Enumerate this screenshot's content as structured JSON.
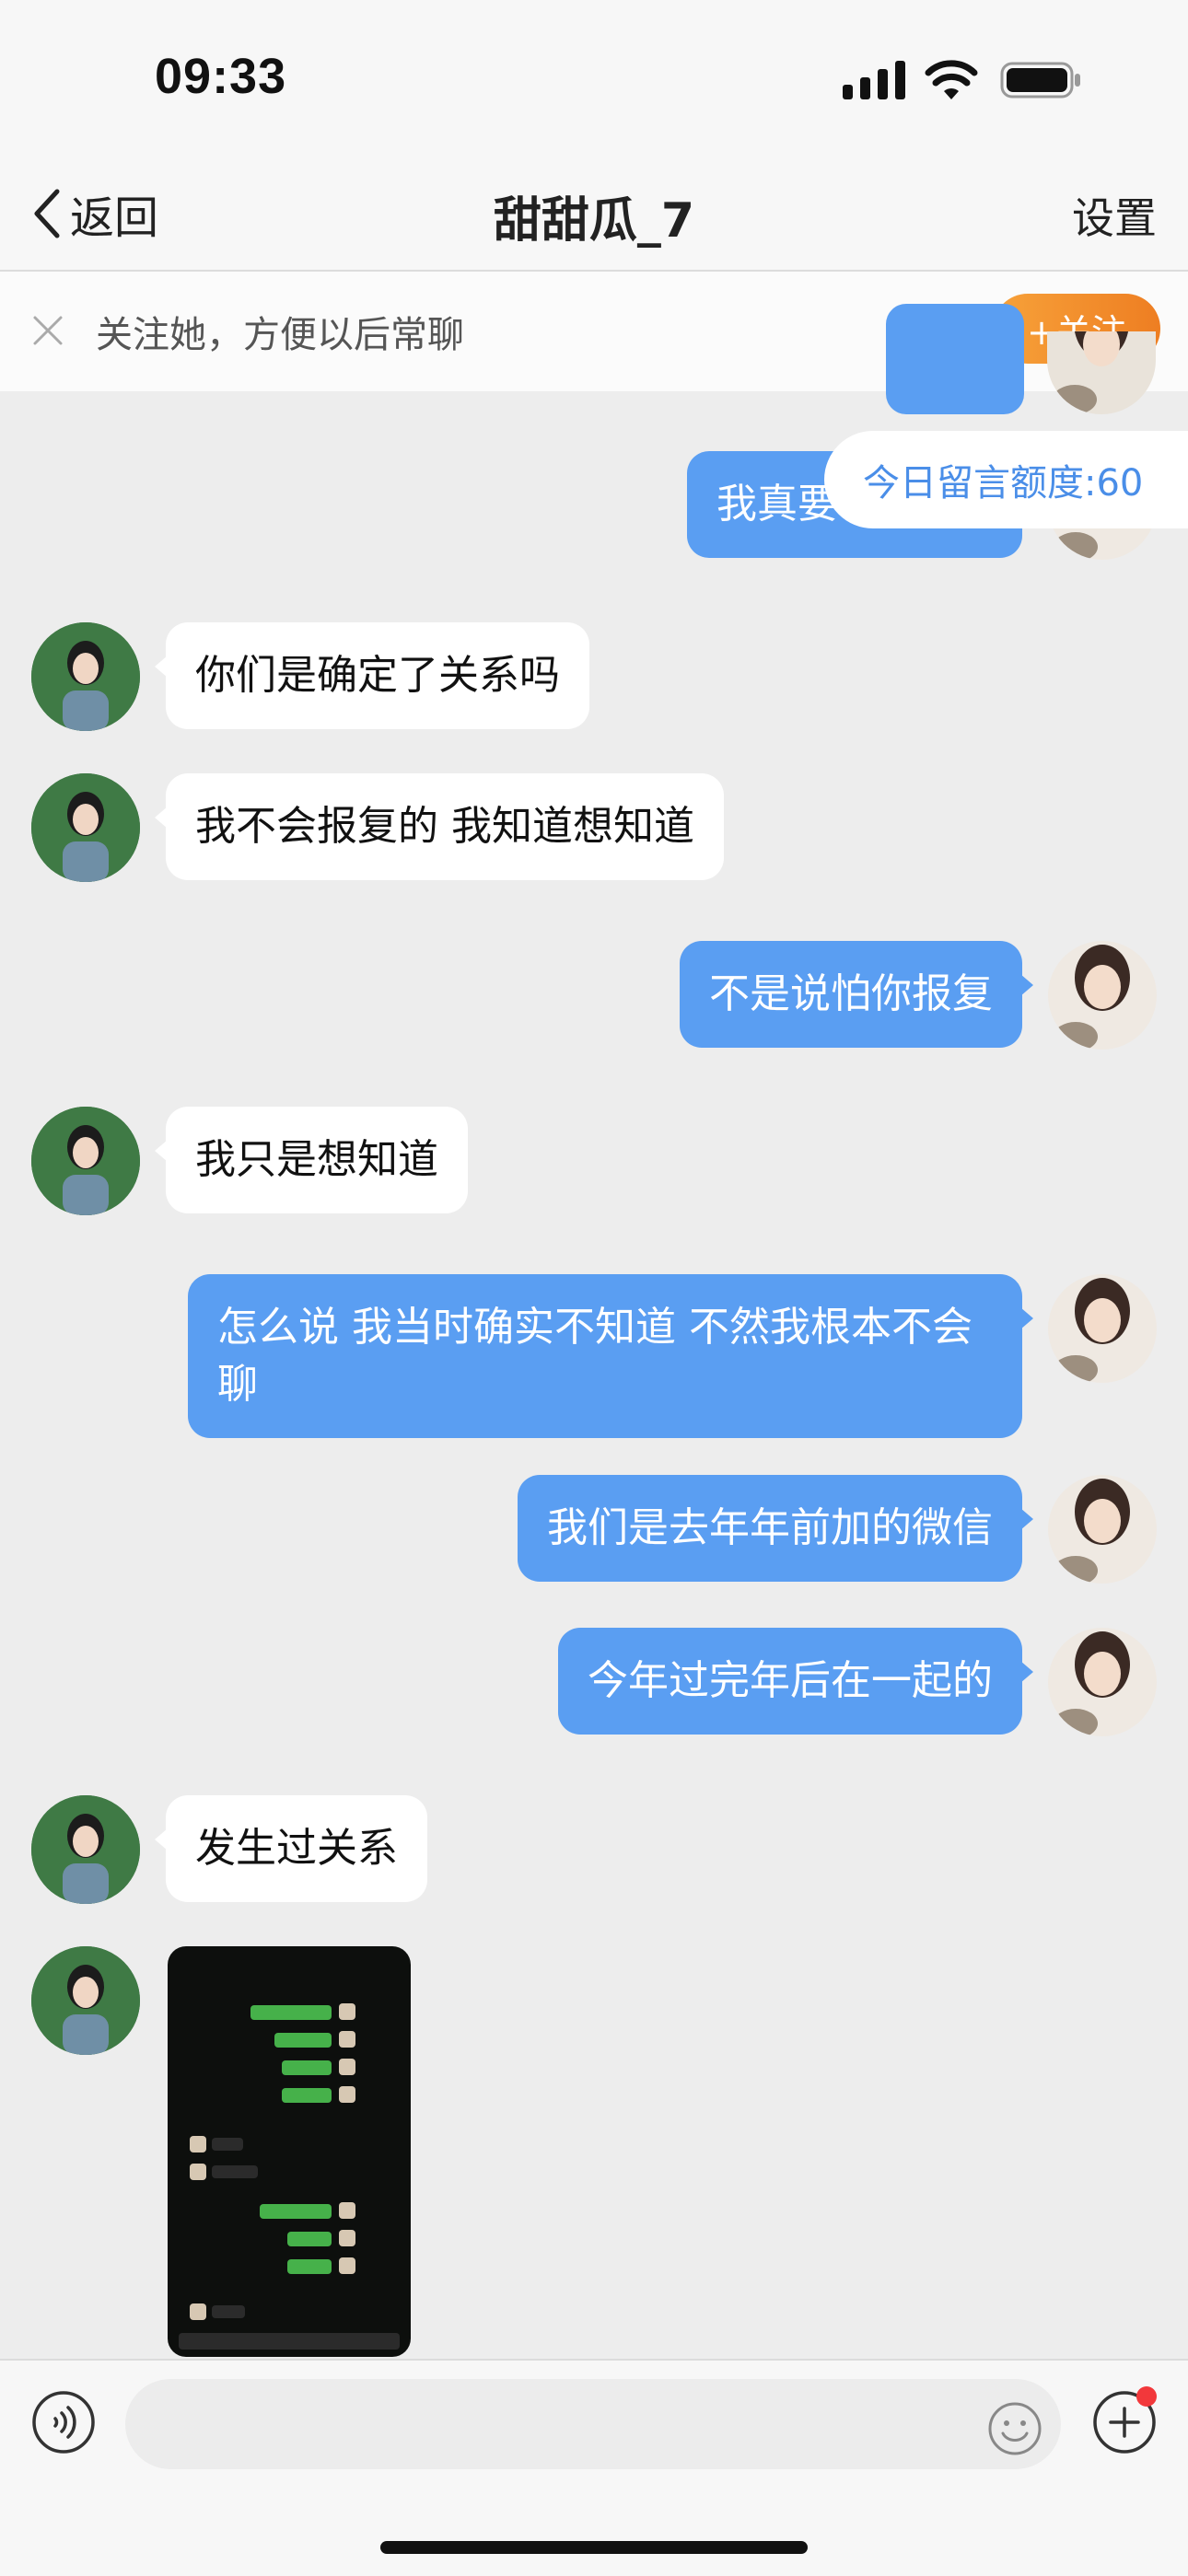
{
  "status_bar": {
    "time": "09:33"
  },
  "nav": {
    "back_label": "返回",
    "title": "甜甜瓜_7",
    "settings_label": "设置"
  },
  "follow_bar": {
    "text": "关注她，方便以后常聊",
    "button_label": "+关注"
  },
  "quota_tag": {
    "text": "今日留言额度:60"
  },
  "messages": [
    {
      "side": "right",
      "text": "我真要"
    },
    {
      "side": "left",
      "text": "你们是确定了关系吗"
    },
    {
      "side": "left",
      "text": "我不会报复的 我知道想知道"
    },
    {
      "side": "right",
      "text": "不是说怕你报复"
    },
    {
      "side": "left",
      "text": "我只是想知道"
    },
    {
      "side": "right",
      "text": "怎么说 我当时确实不知道 不然我根本不会聊"
    },
    {
      "side": "right",
      "text": "我们是去年年前加的微信"
    },
    {
      "side": "right",
      "text": "今年过完年后在一起的"
    },
    {
      "side": "left",
      "text": "发生过关系"
    },
    {
      "side": "left",
      "type": "image",
      "alt": "chat screenshot"
    }
  ],
  "colors": {
    "my_bubble": "#5a9ef2",
    "follow_button": "#f08a28",
    "quota_text": "#4a8ee8"
  }
}
